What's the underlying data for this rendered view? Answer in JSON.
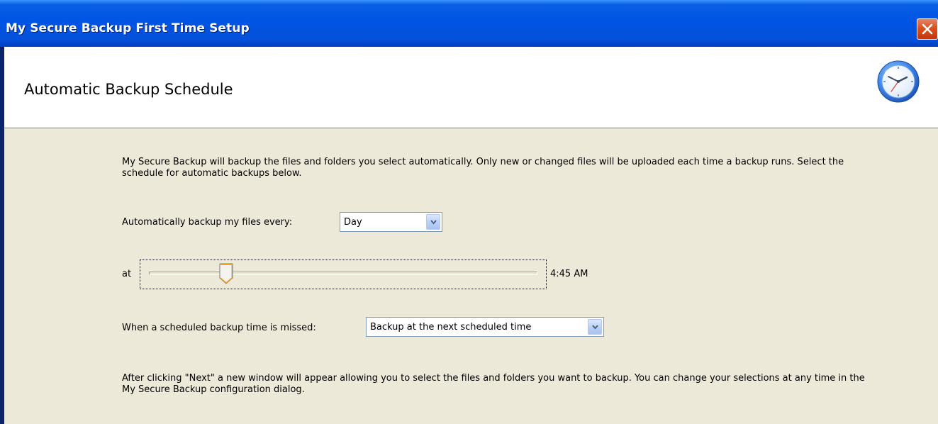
{
  "window": {
    "title": "My Secure Backup First Time Setup"
  },
  "header": {
    "title": "Automatic Backup Schedule",
    "icon": "clock-icon"
  },
  "content": {
    "intro": "My Secure Backup will backup the files and folders you select automatically. Only new or changed files will be uploaded each time a backup runs. Select the schedule for automatic backups below.",
    "frequency": {
      "label": "Automatically backup my files every:",
      "value": "Day"
    },
    "time": {
      "label": "at",
      "value": "4:45 AM",
      "slider_fraction": 0.198
    },
    "missed": {
      "label": "When a scheduled backup time is missed:",
      "value": "Backup at the next scheduled time"
    },
    "outro": "After clicking \"Next\" a new window will appear allowing you to select the files and folders you want to backup. You can change your selections at any time in the My Secure Backup configuration dialog."
  },
  "colors": {
    "titlebar": "#0054e3",
    "dialog_bg": "#ece9d8",
    "close_button": "#d9501f"
  }
}
